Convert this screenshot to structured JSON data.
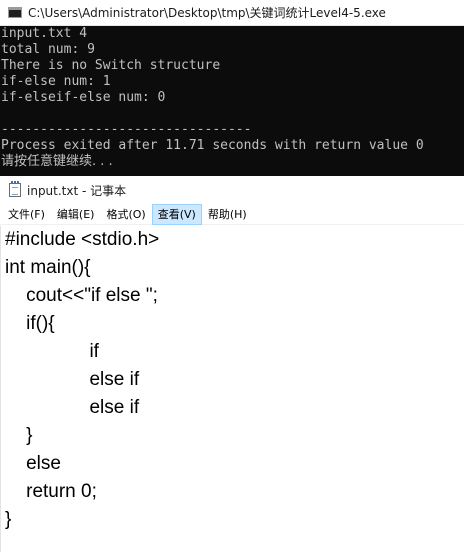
{
  "console": {
    "title": "C:\\Users\\Administrator\\Desktop\\tmp\\关键词统计Level4-5.exe",
    "lines": [
      "input.txt 4",
      "total num: 9",
      "There is no Switch structure",
      "if-else num: 1",
      "if-elseif-else num: 0",
      "",
      "--------------------------------",
      "Process exited after 11.71 seconds with return value 0",
      "请按任意键继续. . ."
    ]
  },
  "notepad": {
    "title": "input.txt - 记事本",
    "menu": [
      "文件(F)",
      "编辑(E)",
      "格式(O)",
      "查看(V)",
      "帮助(H)"
    ],
    "lines": [
      "#include <stdio.h>",
      "int main(){",
      "    cout<<\"if else \";",
      "    if(){",
      "                if",
      "                else if",
      "                else if",
      "    }",
      "    else",
      "    return 0;",
      "}"
    ]
  },
  "colors": {
    "console_bg": "#0c0c0c",
    "console_text": "#c0c0c0",
    "menu_highlight": "#cce8ff"
  }
}
